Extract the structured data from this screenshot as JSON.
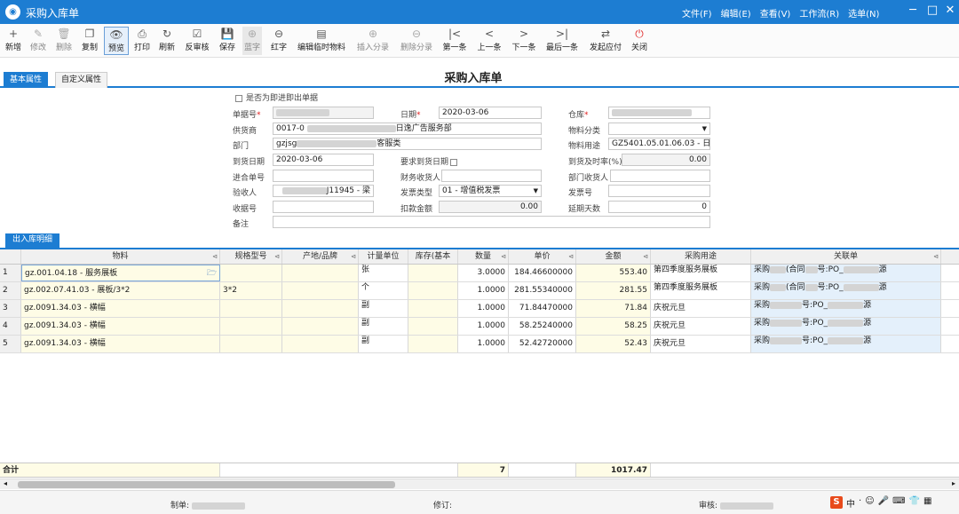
{
  "window": {
    "title": "采购入库单",
    "app_icon": "logo-icon"
  },
  "menu": [
    "文件(F)",
    "编辑(E)",
    "查看(V)",
    "工作流(R)",
    "选单(N)"
  ],
  "window_controls": [
    "─",
    "□",
    "✕"
  ],
  "toolbar": [
    {
      "label": "新增",
      "icon": "+",
      "state": "normal"
    },
    {
      "label": "修改",
      "icon": "✎",
      "state": "disabled"
    },
    {
      "label": "删除",
      "icon": "🗑",
      "state": "disabled"
    },
    {
      "label": "复制",
      "icon": "❐",
      "state": "normal"
    },
    {
      "label": "预览",
      "icon": "👁",
      "state": "selected"
    },
    {
      "label": "打印",
      "icon": "⎙",
      "state": "normal"
    },
    {
      "label": "刷新",
      "icon": "↻",
      "state": "normal"
    },
    {
      "label": "反审核",
      "icon": "☑",
      "state": "normal"
    },
    {
      "label": "保存",
      "icon": "💾",
      "state": "normal"
    },
    {
      "label": "蓝字",
      "icon": "⊕",
      "state": "disabled"
    },
    {
      "label": "红字",
      "icon": "⊖",
      "state": "normal"
    },
    {
      "label": "编辑临时物料",
      "icon": "▤",
      "state": "normal"
    },
    {
      "label": "插入分录",
      "icon": "⊕",
      "state": "disabled"
    },
    {
      "label": "删除分录",
      "icon": "⊖",
      "state": "disabled"
    },
    {
      "label": "第一条",
      "icon": "|<",
      "state": "normal"
    },
    {
      "label": "上一条",
      "icon": "<",
      "state": "normal"
    },
    {
      "label": "下一条",
      "icon": ">",
      "state": "normal"
    },
    {
      "label": "最后一条",
      "icon": ">|",
      "state": "normal"
    },
    {
      "label": "发起应付",
      "icon": "⇄",
      "state": "normal"
    },
    {
      "label": "关闭",
      "icon": "⏻",
      "state": "red"
    }
  ],
  "tabs": [
    "基本属性",
    "自定义属性"
  ],
  "form_title": "采购入库单",
  "form": {
    "checkbox_label": "是否为即进即出单据",
    "bill_no_label": "单据号",
    "date_label": "日期",
    "date_value": "2020-03-06",
    "warehouse_label": "仓库",
    "supplier_label": "供货商",
    "supplier_value_a": "0017-0",
    "supplier_value_b": "日逸广告服务部",
    "material_class_label": "物料分类",
    "dept_label": "部门",
    "dept_value_a": "gzjsg",
    "dept_value_b": "客服类",
    "material_use_label": "物料用途",
    "material_use_value": "GZ5401.05.01.06.03 - 日",
    "arrival_date_label": "到货日期",
    "arrival_date_value": "2020-03-06",
    "req_arrival_label": "要求到货日期",
    "ontime_rate_label": "到货及时率(%)",
    "ontime_rate_value": "0.00",
    "contract_label": "进合单号",
    "finance_receiver_label": "财务收货人",
    "dept_receiver_label": "部门收货人",
    "inspector_label": "验收人",
    "inspector_value": "J11945 - 梁",
    "invoice_type_label": "发票类型",
    "invoice_type_value": "01 - 增值税发票",
    "invoice_no_label": "发票号",
    "receipt_no_label": "收据号",
    "deduct_label": "扣款金额",
    "deduct_value": "0.00",
    "delay_days_label": "延期天数",
    "delay_days_value": "0",
    "remark_label": "备注"
  },
  "grid_tab": "出入库明细",
  "grid": {
    "columns": [
      "物料",
      "规格型号",
      "产地/品牌",
      "计量单位",
      "库存(基本",
      "数量",
      "单价",
      "金额",
      "采购用途",
      "关联单"
    ],
    "rows": [
      {
        "no": "1",
        "material": "gz.001.04.18 - 服务展板",
        "spec": "",
        "unit": "张",
        "qty": "3.0000",
        "price": "184.46600000",
        "amount": "553.40",
        "purpose": "第四季度服务展板",
        "link_a": "采购",
        "link_b": "(合同",
        "link_c": "号:PO_",
        "link_d": "源"
      },
      {
        "no": "2",
        "material": "gz.002.07.41.03 - 展板/3*2",
        "spec": "3*2",
        "unit": "个",
        "qty": "1.0000",
        "price": "281.55340000",
        "amount": "281.55",
        "purpose": "第四季度服务展板",
        "link_a": "采购",
        "link_b": "(合同",
        "link_c": "号:PO_",
        "link_d": "源"
      },
      {
        "no": "3",
        "material": "gz.0091.34.03 - 横幅",
        "spec": "",
        "unit": "副",
        "qty": "1.0000",
        "price": "71.84470000",
        "amount": "71.84",
        "purpose": "庆祝元旦",
        "link_a": "采购",
        "link_b": "",
        "link_c": "号:PO_",
        "link_d": "源"
      },
      {
        "no": "4",
        "material": "gz.0091.34.03 - 横幅",
        "spec": "",
        "unit": "副",
        "qty": "1.0000",
        "price": "58.25240000",
        "amount": "58.25",
        "purpose": "庆祝元旦",
        "link_a": "采购",
        "link_b": "",
        "link_c": "号:PO_",
        "link_d": "源"
      },
      {
        "no": "5",
        "material": "gz.0091.34.03 - 横幅",
        "spec": "",
        "unit": "副",
        "qty": "1.0000",
        "price": "52.42720000",
        "amount": "52.43",
        "purpose": "庆祝元旦",
        "link_a": "采购",
        "link_b": "",
        "link_c": "号:PO_",
        "link_d": "源"
      }
    ],
    "total_label": "合计",
    "total_qty": "7",
    "total_amount": "1017.47"
  },
  "footer": {
    "maker_label": "制单:",
    "revise_label": "修订:",
    "audit_label": "审核:"
  },
  "tray": [
    "S",
    "中",
    "·",
    "☺",
    "🎤",
    "⌨",
    "👕",
    "▦"
  ],
  "colors": {
    "accent": "#1d7dd2",
    "yellow_cell": "#fefce6",
    "blue_cell": "#e4f0fb",
    "required": "#e02020"
  }
}
